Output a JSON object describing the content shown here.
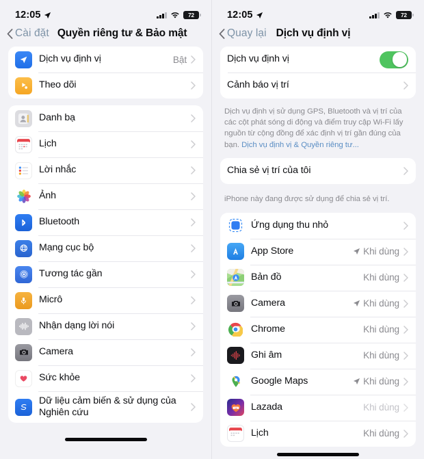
{
  "status_bar": {
    "time": "12:05",
    "battery_level": "72",
    "location_arrow_icon": "location-arrow-icon",
    "cellular_icon": "cellular-signal-icon",
    "wifi_icon": "wifi-icon",
    "battery_icon": "battery-icon"
  },
  "colors": {
    "toggle_on": "#4FC45F",
    "link": "#5B8EC4",
    "back_label": "#7E93A7",
    "page_background": "#F2F2F6",
    "card_background": "#FFFFFF"
  },
  "left_screen": {
    "back_label": "Cài đặt",
    "title": "Quyền riêng tư & Bảo mật",
    "group1": [
      {
        "label": "Dịch vụ định vị",
        "value": "Bật",
        "icon": "location-services-icon"
      },
      {
        "label": "Theo dõi",
        "value": "",
        "icon": "tracking-icon"
      }
    ],
    "group2": [
      {
        "label": "Danh bạ",
        "icon": "contacts-icon"
      },
      {
        "label": "Lịch",
        "icon": "calendar-icon"
      },
      {
        "label": "Lời nhắc",
        "icon": "reminders-icon"
      },
      {
        "label": "Ảnh",
        "icon": "photos-icon"
      },
      {
        "label": "Bluetooth",
        "icon": "bluetooth-icon"
      },
      {
        "label": "Mạng cục bộ",
        "icon": "local-network-icon"
      },
      {
        "label": "Tương tác gần",
        "icon": "nearby-interactions-icon"
      },
      {
        "label": "Micrô",
        "icon": "microphone-icon"
      },
      {
        "label": "Nhận dạng lời nói",
        "icon": "speech-recognition-icon"
      },
      {
        "label": "Camera",
        "icon": "camera-icon"
      },
      {
        "label": "Sức khỏe",
        "icon": "health-icon"
      },
      {
        "label": "Dữ liệu cảm biến & sử dụng của Nghiên cứu",
        "icon": "research-icon"
      }
    ]
  },
  "right_screen": {
    "back_label": "Quay lại",
    "title": "Dịch vụ định vị",
    "toggle_row": {
      "label": "Dịch vụ định vị",
      "enabled": true
    },
    "alert_row": {
      "label": "Cảnh báo vị trí"
    },
    "description": "Dịch vụ định vị sử dụng GPS, Bluetooth và vị trí của các cột phát sóng di động và điểm truy cập Wi-Fi lấy nguồn từ cộng đồng để xác định vị trí gần đúng của bạn. ",
    "description_link": "Dịch vụ định vị & Quyền riêng tư...",
    "share_row": {
      "label": "Chia sẻ vị trí của tôi"
    },
    "share_footnote": "iPhone này đang được sử dụng để chia sẻ vị trí.",
    "apps": [
      {
        "label": "Ứng dụng thu nhỏ",
        "value": "",
        "arrow": false,
        "icon": "mini-app-icon",
        "faded": false
      },
      {
        "label": "App Store",
        "value": "Khi dùng",
        "arrow": true,
        "icon": "app-store-icon",
        "faded": false
      },
      {
        "label": "Bản đồ",
        "value": "Khi dùng",
        "arrow": false,
        "icon": "apple-maps-icon",
        "faded": false
      },
      {
        "label": "Camera",
        "value": "Khi dùng",
        "arrow": true,
        "icon": "camera-icon",
        "faded": false
      },
      {
        "label": "Chrome",
        "value": "Khi dùng",
        "arrow": false,
        "icon": "chrome-icon",
        "faded": false
      },
      {
        "label": "Ghi âm",
        "value": "Khi dùng",
        "arrow": false,
        "icon": "voice-memos-icon",
        "faded": false
      },
      {
        "label": "Google Maps",
        "value": "Khi dùng",
        "arrow": true,
        "icon": "google-maps-icon",
        "faded": false
      },
      {
        "label": "Lazada",
        "value": "Khi dùng",
        "arrow": false,
        "icon": "lazada-icon",
        "faded": true
      },
      {
        "label": "Lịch",
        "value": "Khi dùng",
        "arrow": false,
        "icon": "calendar-icon",
        "faded": false
      }
    ]
  }
}
